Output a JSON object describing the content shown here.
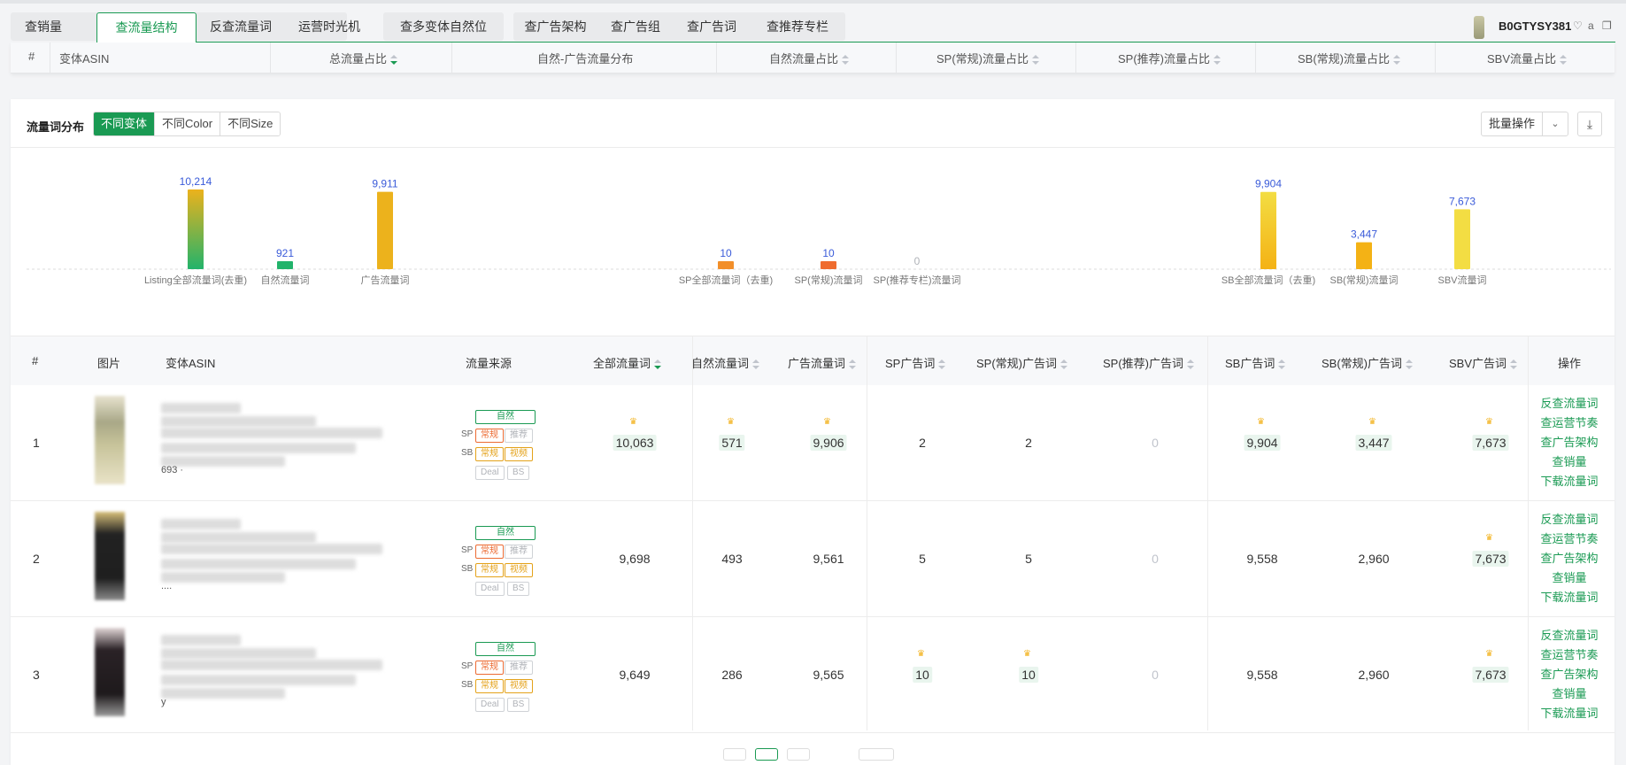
{
  "tabs": {
    "group1": [
      {
        "label": "查销量",
        "active": false
      },
      {
        "label": "查流量结构",
        "active": true
      },
      {
        "label": "反查流量词",
        "active": false
      },
      {
        "label": "运营时光机",
        "active": false
      }
    ],
    "group2": [
      {
        "label": "查多变体自然位"
      }
    ],
    "group3": [
      {
        "label": "查广告架构"
      },
      {
        "label": "查广告组"
      },
      {
        "label": "查广告词"
      },
      {
        "label": "查推荐专栏"
      }
    ]
  },
  "asin_label": "B0GTYSY381",
  "top_table": {
    "headers": [
      "#",
      "变体ASIN",
      "总流量占比",
      "自然-广告流量分布",
      "自然流量占比",
      "SP(常规)流量占比",
      "SP(推荐)流量占比",
      "SB(常规)流量占比",
      "SBV流量占比"
    ]
  },
  "panel": {
    "title": "流量词分布",
    "segments": [
      "不同变体",
      "不同Color",
      "不同Size"
    ],
    "batch_label": "批量操作"
  },
  "chart_data": {
    "type": "bar",
    "categories": [
      "Listing全部流量词(去重)",
      "自然流量词",
      "广告流量词",
      "SP全部流量词（去重)",
      "SP(常规)流量词",
      "SP(推荐专栏)流量词",
      "SB全部流量词（去重)",
      "SB(常规)流量词",
      "SBV流量词"
    ],
    "values": [
      10214,
      921,
      9911,
      10,
      10,
      0,
      9904,
      3447,
      7673
    ],
    "value_labels": [
      "10,214",
      "921",
      "9,911",
      "10",
      "10",
      "0",
      "9,904",
      "3,447",
      "7,673"
    ],
    "ylim": [
      0,
      10214
    ],
    "colors": [
      "#ecb21c:#22b36b",
      "#22b36b",
      "#ecb21c",
      "#f28f2a",
      "#ef6c2f",
      "#cccccc",
      "#f3dd43:#f4b215",
      "#f4b215",
      "#f3dd43"
    ],
    "grid": false
  },
  "table": {
    "headers": [
      "#",
      "图片",
      "变体ASIN",
      "流量来源",
      "全部流量词",
      "自然流量词",
      "广告流量词",
      "SP广告词",
      "SP(常规)广告词",
      "SP(推荐)广告词",
      "SB广告词",
      "SB(常规)广告词",
      "SBV广告词",
      "操作"
    ],
    "source_tags": {
      "natural": "自然",
      "sp": "SP",
      "sb": "SB",
      "regular": "常规",
      "recommend": "推荐",
      "video": "视频",
      "deal": "Deal",
      "bs": "BS"
    },
    "rows": [
      {
        "idx": "1",
        "total": "10,063",
        "natural": "571",
        "ad": "9,906",
        "sp": "2",
        "sp_reg": "2",
        "sp_rec": "0",
        "sb": "9,904",
        "sb_reg": "3,447",
        "sbv": "7,673",
        "partial": "693 ·"
      },
      {
        "idx": "2",
        "total": "9,698",
        "natural": "493",
        "ad": "9,561",
        "sp": "5",
        "sp_reg": "5",
        "sp_rec": "0",
        "sb": "9,558",
        "sb_reg": "2,960",
        "sbv": "7,673",
        "partial": "...."
      },
      {
        "idx": "3",
        "total": "9,649",
        "natural": "286",
        "ad": "9,565",
        "sp": "10",
        "sp_reg": "10",
        "sp_rec": "0",
        "sb": "9,558",
        "sb_reg": "2,960",
        "sbv": "7,673",
        "partial": "y"
      }
    ],
    "ops": [
      "反查流量词",
      "查运营节奏",
      "查广告架构",
      "查销量",
      "下载流量词"
    ]
  }
}
